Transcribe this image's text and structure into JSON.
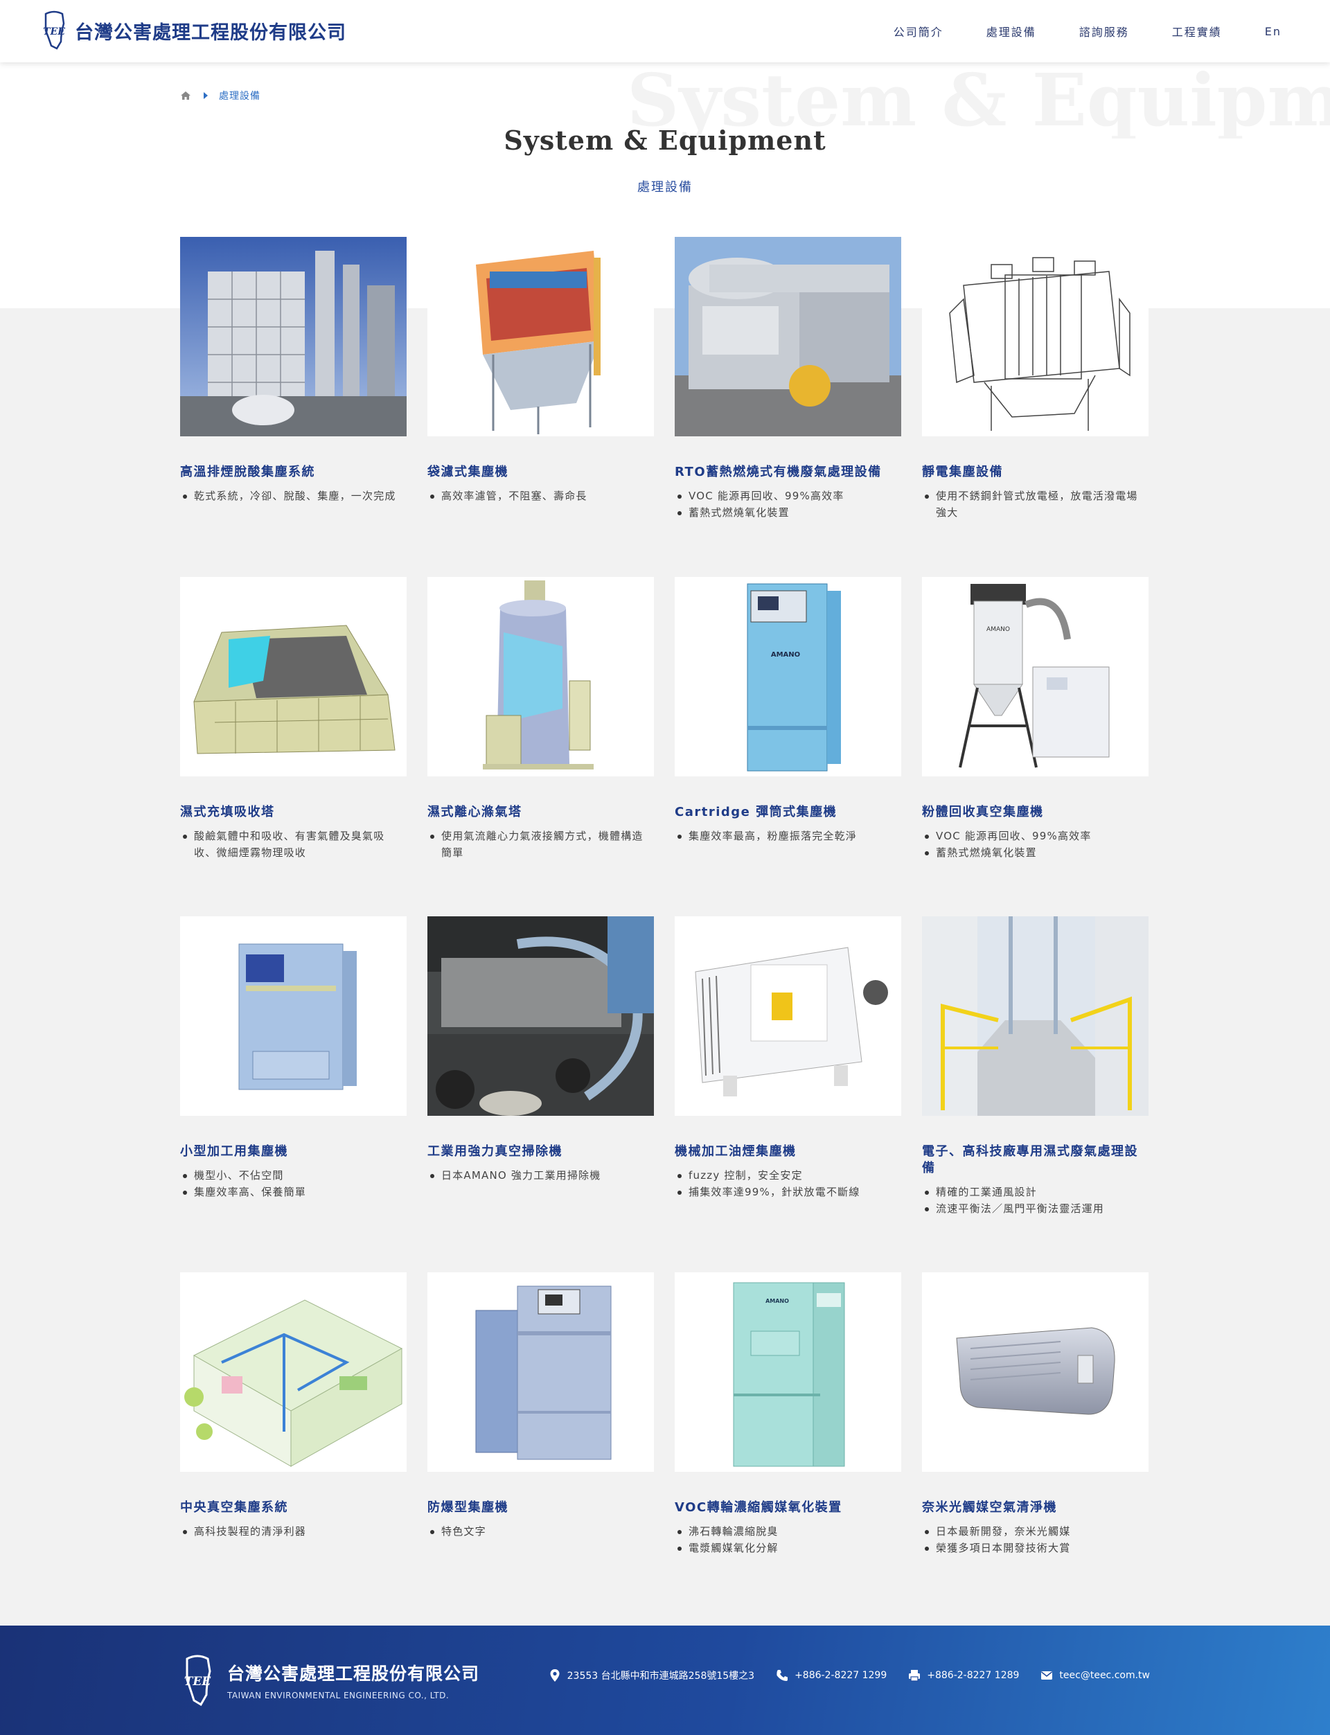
{
  "header": {
    "logo_text": "台灣公害處理工程股份有限公司",
    "nav": [
      "公司簡介",
      "處理設備",
      "諮詢服務",
      "工程實績",
      "En"
    ]
  },
  "page": {
    "watermark": "System & Equipment",
    "breadcrumb_current": "處理設備",
    "title": "System & Equipment",
    "subtitle": "處理設備"
  },
  "products": [
    {
      "title": "高溫排煙脫酸集塵系統",
      "bullets": [
        "乾式系統，冷卻、脫酸、集塵，一次完成"
      ],
      "image": "high-temp-flue-gas-plant-photo"
    },
    {
      "title": "袋濾式集塵機",
      "bullets": [
        "高效率濾管，不阻塞、壽命長"
      ],
      "image": "bag-filter-collector-render"
    },
    {
      "title": "RTO蓄熱燃燒式有機廢氣處理設備",
      "bullets": [
        "VOC 能源再回收、99%高效率",
        "蓄熱式燃燒氧化裝置"
      ],
      "image": "rto-plant-photo"
    },
    {
      "title": "靜電集塵設備",
      "bullets": [
        "使用不銹鋼針管式放電極，放電活潑電場強大"
      ],
      "image": "electrostatic-precipitator-drawing"
    },
    {
      "title": "濕式充填吸收塔",
      "bullets": [
        "酸鹼氣體中和吸收、有害氣體及臭氣吸收、微細煙霧物理吸收"
      ],
      "image": "wet-packed-scrubber-render"
    },
    {
      "title": "濕式離心滌氣塔",
      "bullets": [
        "使用氣流離心力氣液接觸方式，機體構造簡單"
      ],
      "image": "centrifugal-scrubber-render"
    },
    {
      "title": "Cartridge 彈筒式集塵機",
      "bullets": [
        "集塵效率最高，粉塵振落完全乾淨"
      ],
      "image": "cartridge-collector-photo"
    },
    {
      "title": "粉體回收真空集塵機",
      "bullets": [
        "VOC 能源再回收、99%高效率",
        "蓄熱式燃燒氧化裝置"
      ],
      "image": "powder-vacuum-collector-photo"
    },
    {
      "title": "小型加工用集塵機",
      "bullets": [
        "機型小、不佔空間",
        "集塵效率高、保養簡單"
      ],
      "image": "small-dust-collector-photo"
    },
    {
      "title": "工業用強力真空掃除機",
      "bullets": [
        "日本AMANO 強力工業用掃除機"
      ],
      "image": "industrial-vacuum-photo"
    },
    {
      "title": "機械加工油煙集塵機",
      "bullets": [
        "fuzzy 控制，安全安定",
        "捕集效率達99%，針狀放電不斷線"
      ],
      "image": "oil-mist-collector-photo"
    },
    {
      "title": "電子、高科技廠專用濕式廢氣處理設備",
      "bullets": [
        "精確的工業通風設計",
        "流速平衡法／風門平衡法靈活運用"
      ],
      "image": "hightech-wet-scrubber-photo"
    },
    {
      "title": "中央真空集塵系統",
      "bullets": [
        "高科技製程的清淨利器"
      ],
      "image": "central-vacuum-system-illustration"
    },
    {
      "title": "防爆型集塵機",
      "bullets": [
        "特色文字"
      ],
      "image": "explosion-proof-collector-photo"
    },
    {
      "title": "VOC轉輪濃縮觸媒氧化裝置",
      "bullets": [
        "沸石轉輪濃縮脫臭",
        "電漿觸媒氧化分解"
      ],
      "image": "voc-remover-photo"
    },
    {
      "title": "奈米光觸媒空氣清淨機",
      "bullets": [
        "日本最新開發，奈米光觸媒",
        "榮獲多項日本開發技術大賞"
      ],
      "image": "photocatalyst-purifier-photo"
    }
  ],
  "footer": {
    "logo_cn": "台灣公害處理工程股份有限公司",
    "logo_en": "TAIWAN ENVIRONMENTAL ENGINEERING CO., LTD.",
    "address": "23553 台北縣中和市連城路258號15樓之3",
    "phone": "+886-2-8227 1299",
    "fax": "+886-2-8227 1289",
    "email": "teec@teec.com.tw"
  },
  "colors": {
    "brand": "#1f3c88",
    "accent": "#2e6fc4",
    "footer_start": "#1a3277",
    "footer_end": "#2e7fcc"
  }
}
